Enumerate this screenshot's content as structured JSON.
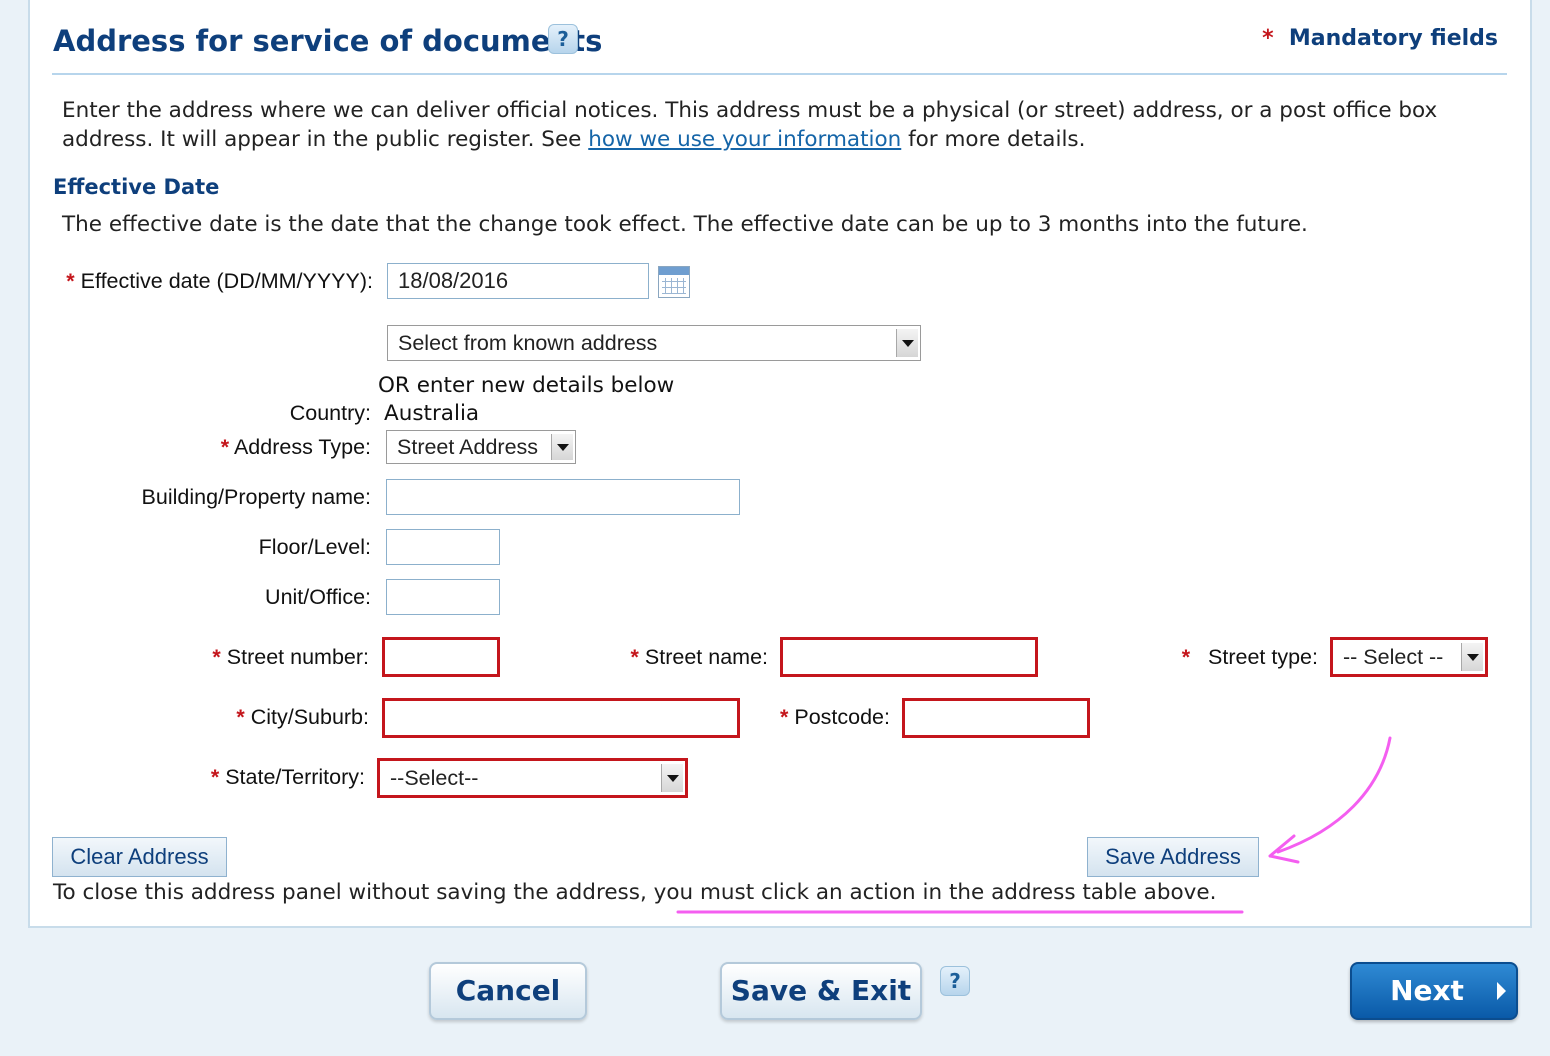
{
  "section": {
    "title": "Address for service of documents",
    "mandatory_asterisk": "*",
    "mandatory_label": "Mandatory fields",
    "intro_before_link": "Enter the address where we can deliver official notices. This address must be a physical (or street) address, or a post office box address. It will appear in the public register. See ",
    "intro_link": "how we use your information",
    "intro_after_link": " for more details."
  },
  "effective": {
    "heading": "Effective Date",
    "description": "The effective date is the date that the change took effect. The effective date can be up to 3 months into the future.",
    "label": "Effective date (DD/MM/YYYY):",
    "value": "18/08/2016"
  },
  "address": {
    "known_address_selected": "Select from known address",
    "or_text": "OR enter new details below",
    "country_label": "Country:",
    "country_value": "Australia",
    "type_label": "Address Type:",
    "type_selected": "Street Address",
    "building_label": "Building/Property name:",
    "building_value": "",
    "floor_label": "Floor/Level:",
    "floor_value": "",
    "unit_label": "Unit/Office:",
    "unit_value": "",
    "street_number_label": "Street number:",
    "street_number_value": "",
    "street_name_label": "Street name:",
    "street_name_value": "",
    "street_type_label": "Street type:",
    "street_type_selected": "-- Select --",
    "city_label": "City/Suburb:",
    "city_value": "",
    "postcode_label": "Postcode:",
    "postcode_value": "",
    "state_label": "State/Territory:",
    "state_selected": "--Select--",
    "required_mark": "*"
  },
  "actions": {
    "clear_label": "Clear Address",
    "save_label": "Save Address",
    "note_before": "To close this address panel without saving the address, ",
    "note_highlight": "you must click an action in the address table above.",
    "cancel_label": "Cancel",
    "save_exit_label": "Save & Exit",
    "next_label": "Next"
  },
  "annotation": {
    "color": "#f45ef0"
  },
  "colors": {
    "heading": "#0e3f7c",
    "required": "#c4161c",
    "error_border": "#c4161c",
    "primary_button": "#0a5aa8"
  },
  "icons": {
    "help": "help-icon",
    "calendar": "calendar-icon",
    "dropdown": "chevron-down-icon",
    "next_arrow": "chevron-right-icon"
  }
}
